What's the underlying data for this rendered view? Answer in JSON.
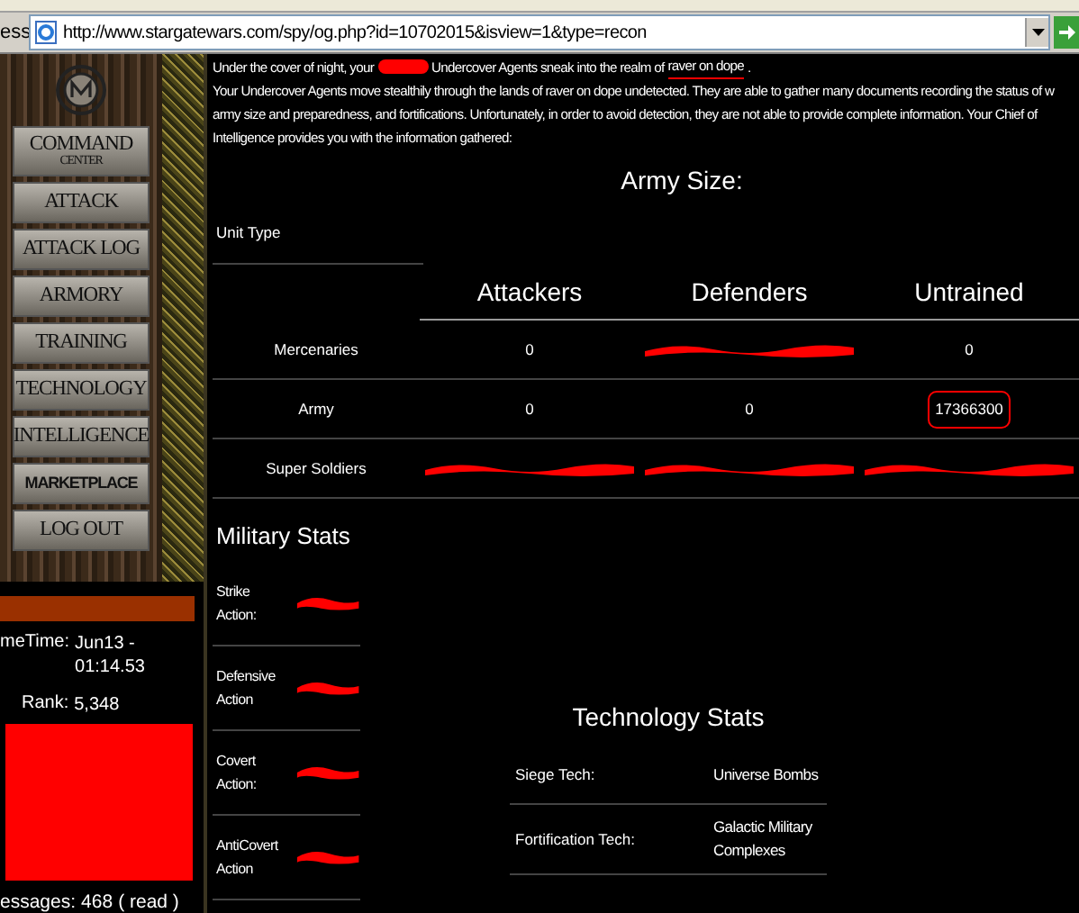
{
  "address_bar": {
    "label": "ess",
    "url": "http://www.stargatewars.com/spy/og.php?id=10702015&isview=1&type=recon"
  },
  "nav": [
    {
      "label": "COMMAND",
      "sub": "CENTER"
    },
    {
      "label": "ATTACK"
    },
    {
      "label": "ATTACK LOG"
    },
    {
      "label": "ARMORY"
    },
    {
      "label": "TRAINING"
    },
    {
      "label": "TECHNOLOGY"
    },
    {
      "label": "INTELLIGENCE"
    },
    {
      "label": "MARKETPLACE",
      "kind": "sans"
    },
    {
      "label": "LOG OUT"
    }
  ],
  "player_info": {
    "time_label": "meTime:",
    "time_value": "Jun13 - 01:14.53",
    "rank_label": "Rank:",
    "rank_value": "5,348",
    "messages_label": "essages:",
    "messages_value": "468",
    "read_link": "( read )"
  },
  "report": {
    "intro_before": "Under the cover of night, your",
    "intro_after": "Undercover Agents sneak into the realm of",
    "target": "raver on dope",
    "intro_end": ".",
    "lines": [
      "Your Undercover Agents move stealthily through the lands of raver on dope undetected. They are able to gather many documents recording the status of w",
      "army size and preparedness, and fortifications. Unfortunately, in order to avoid detection, they are not able to provide complete information. Your Chief of",
      "Intelligence provides you with the information gathered:"
    ]
  },
  "army_size": {
    "title": "Army Size:",
    "unit_type_label": "Unit Type",
    "columns": [
      "Attackers",
      "Defenders",
      "Untrained"
    ],
    "rows": [
      {
        "unit": "Mercenaries",
        "cells": [
          {
            "kind": "text",
            "value": "0"
          },
          {
            "kind": "redacted"
          },
          {
            "kind": "text",
            "value": "0"
          }
        ]
      },
      {
        "unit": "Army",
        "cells": [
          {
            "kind": "text",
            "value": "0"
          },
          {
            "kind": "text",
            "value": "0"
          },
          {
            "kind": "text",
            "value": "17366300",
            "circled": true
          }
        ]
      },
      {
        "unit": "Super Soldiers",
        "cells": [
          {
            "kind": "redacted"
          },
          {
            "kind": "redacted"
          },
          {
            "kind": "redacted"
          }
        ]
      }
    ]
  },
  "military_stats": {
    "title": "Military Stats",
    "rows": [
      {
        "label": "Strike Action:",
        "kind": "redacted"
      },
      {
        "label": "Defensive Action",
        "kind": "redacted"
      },
      {
        "label": "Covert Action:",
        "kind": "redacted"
      },
      {
        "label": "AntiCovert Action",
        "kind": "redacted"
      }
    ]
  },
  "technology_stats": {
    "title": "Technology Stats",
    "rows": [
      {
        "label": "Siege Tech:",
        "value": "Universe Bombs"
      },
      {
        "label": "Fortification Tech:",
        "value": "Galactic Military Complexes"
      }
    ]
  }
}
